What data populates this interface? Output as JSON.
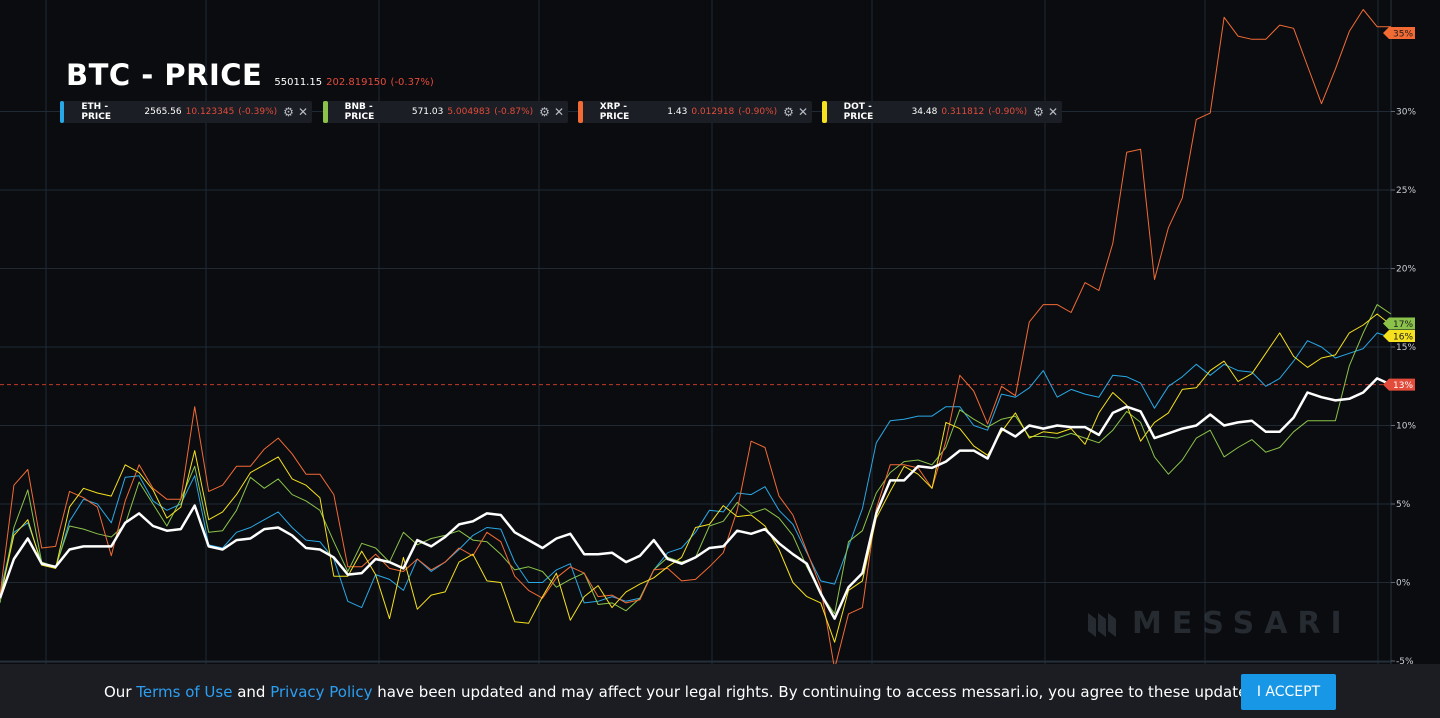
{
  "header": {
    "title": "BTC - PRICE",
    "price": "55011.15",
    "change": "202.819150",
    "change_pct": "(-0.37%)"
  },
  "legends": [
    {
      "label": "ETH - PRICE",
      "value": "2565.56",
      "change": "10.123345",
      "change_pct": "(-0.39%)",
      "color": "#29a8e6"
    },
    {
      "label": "BNB - PRICE",
      "value": "571.03",
      "change": "5.004983",
      "change_pct": "(-0.87%)",
      "color": "#8bc34a"
    },
    {
      "label": "XRP - PRICE",
      "value": "1.43",
      "change": "0.012918",
      "change_pct": "(-0.90%)",
      "color": "#f26b35"
    },
    {
      "label": "DOT - PRICE",
      "value": "34.48",
      "change": "0.311812",
      "change_pct": "(-0.90%)",
      "color": "#f5e11d"
    }
  ],
  "icons": {
    "settings": "gear-icon",
    "close": "close-icon",
    "logo": "messari-logo-icon"
  },
  "watermark": "MESSARI",
  "consent": {
    "prefix": "Our ",
    "terms_link": "Terms of Use",
    "middle": " and ",
    "privacy_link": "Privacy Policy",
    "suffix": " have been updated and may affect your legal rights. By continuing to access messari.io, you agree to these updates.",
    "accept_button": "I ACCEPT"
  },
  "chart_data": {
    "type": "line",
    "yaxis": {
      "ticks": [
        "-5%",
        "0%",
        "5%",
        "10%",
        "15%",
        "20%",
        "25%",
        "30%"
      ],
      "ylim": [
        -5.5,
        36.5
      ],
      "unit": "%"
    },
    "xlim": [
      0,
      91
    ],
    "reference_line": {
      "value": 12.6,
      "label": "13%"
    },
    "end_labels": [
      {
        "series": "XRP - PRICE",
        "label": "35%",
        "color": "#f26b35"
      },
      {
        "series": "BNB - PRICE",
        "label": "17%",
        "color": "#8bc34a"
      },
      {
        "series": "DOT - PRICE",
        "label": "16%",
        "color": "#f5e11d"
      },
      {
        "series": "BTC - PRICE",
        "label": "13%",
        "color": "#e34b3b"
      }
    ],
    "series": [
      {
        "name": "BTC - PRICE",
        "color": "#ffffff",
        "width": 2.5,
        "values": [
          -1.0,
          1.5,
          2.8,
          1.2,
          1.0,
          2.1,
          2.3,
          2.3,
          2.3,
          3.8,
          4.4,
          3.6,
          3.3,
          3.4,
          4.9,
          2.3,
          2.1,
          2.7,
          2.8,
          3.4,
          3.5,
          3.0,
          2.2,
          2.1,
          1.6,
          0.5,
          0.6,
          1.5,
          1.3,
          0.9,
          2.7,
          2.3,
          2.9,
          3.7,
          3.9,
          4.4,
          4.3,
          3.2,
          2.7,
          2.2,
          2.8,
          3.1,
          1.8,
          1.8,
          1.9,
          1.3,
          1.7,
          2.7,
          1.5,
          1.2,
          1.6,
          2.2,
          2.3,
          3.3,
          3.1,
          3.4,
          2.5,
          1.8,
          1.2,
          -0.7,
          -2.3,
          -0.3,
          0.6,
          4.4,
          6.5,
          6.5,
          7.4,
          7.3,
          7.7,
          8.4,
          8.4,
          7.9,
          9.8,
          9.3,
          10.0,
          9.8,
          10.0,
          9.9,
          9.9,
          9.4,
          10.8,
          11.2,
          10.9,
          9.2,
          9.5,
          9.8,
          10.0,
          10.7,
          10.0,
          10.2,
          10.3,
          9.6,
          9.6,
          10.5,
          12.1,
          11.8,
          11.6,
          11.7,
          12.1,
          13.0,
          12.6
        ]
      },
      {
        "name": "ETH - PRICE",
        "color": "#29a8e6",
        "width": 1,
        "values": [
          -0.7,
          3.2,
          3.8,
          1.3,
          0.9,
          3.9,
          5.3,
          5.0,
          3.8,
          6.7,
          6.8,
          5.2,
          4.6,
          5.0,
          6.8,
          2.4,
          2.2,
          3.2,
          3.5,
          4.0,
          4.5,
          3.5,
          2.7,
          2.6,
          1.5,
          -1.2,
          -1.6,
          0.5,
          0.2,
          -0.5,
          1.5,
          0.7,
          1.3,
          2.1,
          3.0,
          3.5,
          3.4,
          1.3,
          0.0,
          0.0,
          0.8,
          1.2,
          -1.3,
          -1.2,
          -0.9,
          -1.2,
          -1.0,
          0.8,
          1.9,
          2.2,
          3.2,
          4.6,
          4.5,
          5.7,
          5.6,
          6.1,
          4.6,
          3.7,
          1.9,
          0.1,
          -0.1,
          2.3,
          4.7,
          8.9,
          10.3,
          10.4,
          10.6,
          10.6,
          11.2,
          11.2,
          10.0,
          9.7,
          12.0,
          11.8,
          12.4,
          13.5,
          11.8,
          12.3,
          12.0,
          11.8,
          13.2,
          13.1,
          12.7,
          11.1,
          12.5,
          13.1,
          13.9,
          13.2,
          13.9,
          13.5,
          13.4,
          12.5,
          13.0,
          14.1,
          15.4,
          15.0,
          14.3,
          14.6,
          14.9,
          15.9,
          15.6
        ]
      },
      {
        "name": "BNB - PRICE",
        "color": "#8bc34a",
        "width": 1,
        "values": [
          -1.3,
          3.5,
          5.9,
          1.3,
          1.0,
          3.6,
          3.4,
          3.1,
          2.9,
          3.7,
          6.4,
          5.0,
          3.6,
          5.3,
          7.4,
          3.2,
          3.3,
          4.6,
          6.7,
          6.0,
          6.6,
          5.6,
          5.2,
          4.6,
          2.6,
          0.7,
          2.5,
          2.2,
          1.3,
          3.2,
          2.4,
          2.8,
          3.0,
          3.3,
          2.7,
          2.6,
          1.8,
          0.8,
          1.0,
          0.7,
          -0.3,
          0.2,
          0.6,
          -1.4,
          -1.3,
          -1.8,
          -1.0,
          0.8,
          1.6,
          1.3,
          1.6,
          3.6,
          3.9,
          5.1,
          4.4,
          4.7,
          4.1,
          3.0,
          1.0,
          -0.7,
          -2.0,
          2.6,
          3.3,
          5.7,
          7.0,
          7.7,
          7.8,
          7.5,
          8.6,
          11.0,
          10.4,
          9.9,
          10.4,
          10.6,
          9.3,
          9.3,
          9.2,
          9.5,
          9.2,
          8.9,
          9.7,
          10.9,
          10.2,
          8.0,
          6.9,
          7.8,
          9.2,
          9.7,
          8.0,
          8.6,
          9.1,
          8.3,
          8.6,
          9.6,
          10.3,
          10.3,
          10.3,
          13.8,
          15.9,
          17.7,
          17.1
        ]
      },
      {
        "name": "XRP - PRICE",
        "color": "#f26b35",
        "width": 1,
        "values": [
          -0.8,
          6.2,
          7.2,
          2.2,
          2.3,
          5.8,
          5.4,
          4.8,
          1.7,
          5.2,
          7.5,
          6.0,
          5.3,
          5.3,
          11.2,
          5.8,
          6.2,
          7.4,
          7.4,
          8.5,
          9.2,
          8.2,
          6.9,
          6.9,
          5.6,
          1.0,
          1.0,
          1.8,
          0.9,
          0.7,
          1.5,
          0.8,
          1.3,
          2.2,
          1.7,
          3.2,
          2.6,
          0.4,
          -0.5,
          -1.0,
          0.3,
          1.0,
          0.6,
          -0.9,
          -0.8,
          -1.3,
          -1.1,
          0.8,
          0.9,
          0.1,
          0.2,
          1.0,
          1.9,
          4.6,
          9.0,
          8.6,
          5.5,
          4.3,
          2.0,
          -0.3,
          -5.5,
          -2.0,
          -1.6,
          4.7,
          7.5,
          7.5,
          7.3,
          6.0,
          9.0,
          13.2,
          12.2,
          10.1,
          12.5,
          11.9,
          16.6,
          17.7,
          17.7,
          17.2,
          19.1,
          18.6,
          21.6,
          27.4,
          27.6,
          19.3,
          22.6,
          24.5,
          29.5,
          29.9,
          36.0,
          34.8,
          34.6,
          34.6,
          35.5,
          35.3,
          32.9,
          30.5,
          32.7,
          35.1,
          36.5,
          35.4,
          35.4
        ]
      },
      {
        "name": "DOT - PRICE",
        "color": "#f5e11d",
        "width": 1,
        "values": [
          -1.0,
          3.0,
          4.0,
          1.1,
          0.9,
          4.8,
          6.0,
          5.7,
          5.5,
          7.5,
          7.0,
          5.9,
          4.1,
          4.8,
          8.4,
          4.0,
          4.5,
          5.6,
          7.0,
          7.5,
          8.0,
          6.6,
          6.2,
          5.4,
          0.4,
          0.4,
          2.0,
          0.5,
          -2.3,
          1.6,
          -1.7,
          -0.8,
          -0.6,
          1.3,
          1.8,
          0.1,
          0.0,
          -2.5,
          -2.6,
          -0.9,
          0.6,
          -2.4,
          -0.9,
          -0.2,
          -1.6,
          -0.6,
          -0.1,
          0.3,
          1.0,
          1.6,
          3.5,
          3.7,
          4.9,
          4.2,
          4.3,
          3.6,
          2.1,
          0.0,
          -0.9,
          -1.3,
          -3.8,
          -0.5,
          0.1,
          4.1,
          5.8,
          7.4,
          6.9,
          6.0,
          10.2,
          9.8,
          8.7,
          8.1,
          9.6,
          10.8,
          9.2,
          9.6,
          9.5,
          9.8,
          8.8,
          10.8,
          12.1,
          11.3,
          9.0,
          10.2,
          10.8,
          12.3,
          12.4,
          13.5,
          14.1,
          12.8,
          13.3,
          14.6,
          15.9,
          14.4,
          13.7,
          14.3,
          14.5,
          15.9,
          16.4,
          17.1,
          16.4
        ]
      }
    ]
  }
}
